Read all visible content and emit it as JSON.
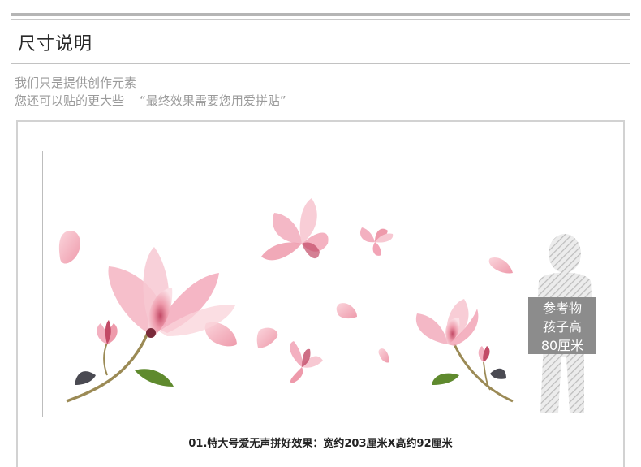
{
  "section": {
    "title": "尺寸说明",
    "description_line1": "我们只是提供创作元素",
    "description_line2": "您还可以贴的更大些    “最终效果需要您用爱拼贴”"
  },
  "product_image": {
    "reference_label": [
      "参考物",
      "孩子高",
      "80厘米"
    ],
    "caption": "01.特大号爱无声拼好效果：宽约203厘米X高约92厘米"
  },
  "colors": {
    "petal_light": "#f6c3cd",
    "petal_mid": "#ee9aab",
    "petal_deep": "#c24a66",
    "stem": "#8a7a4a",
    "leaf": "#5f8a2e",
    "reference_box": "#8c8c8c"
  }
}
